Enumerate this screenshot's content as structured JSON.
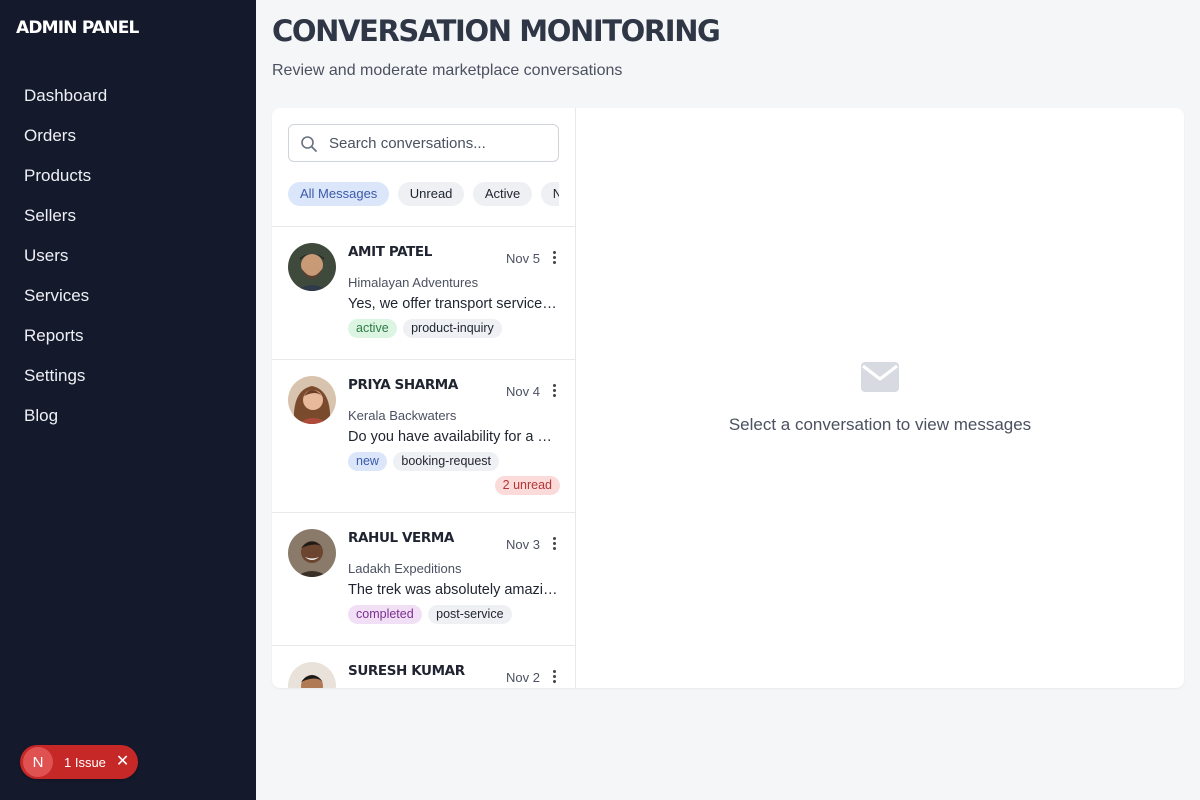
{
  "sidebar": {
    "brand": "ADMIN PANEL",
    "items": [
      {
        "label": "Dashboard"
      },
      {
        "label": "Orders"
      },
      {
        "label": "Products"
      },
      {
        "label": "Sellers"
      },
      {
        "label": "Users"
      },
      {
        "label": "Services"
      },
      {
        "label": "Reports"
      },
      {
        "label": "Settings"
      },
      {
        "label": "Blog"
      }
    ]
  },
  "issue_badge": {
    "initial": "N",
    "label": "1 Issue",
    "close_icon": "close-icon",
    "color": "#c62828"
  },
  "header": {
    "title": "CONVERSATION MONITORING",
    "subtitle": "Review and moderate marketplace conversations"
  },
  "search": {
    "placeholder": "Search conversations...",
    "value": "",
    "icon": "search-icon"
  },
  "filters": [
    {
      "label": "All Messages",
      "active": true
    },
    {
      "label": "Unread",
      "active": false
    },
    {
      "label": "Active",
      "active": false
    },
    {
      "label": "Ne",
      "active": false
    }
  ],
  "conversations": [
    {
      "name": "AMIT PATEL",
      "date": "Nov 5",
      "shop": "Himalayan Adventures",
      "message": "Yes, we offer transport services from the city center.",
      "tags": [
        {
          "label": "active",
          "style": "green"
        },
        {
          "label": "product-inquiry",
          "style": "gray"
        }
      ],
      "unread": ""
    },
    {
      "name": "PRIYA SHARMA",
      "date": "Nov 4",
      "shop": "Kerala Backwaters",
      "message": "Do you have availability for a houseboat stay next weekend?",
      "tags": [
        {
          "label": "new",
          "style": "blue"
        },
        {
          "label": "booking-request",
          "style": "gray"
        }
      ],
      "unread": "2 unread"
    },
    {
      "name": "RAHUL VERMA",
      "date": "Nov 3",
      "shop": "Ladakh Expeditions",
      "message": "The trek was absolutely amazing, thank you!",
      "tags": [
        {
          "label": "completed",
          "style": "purple"
        },
        {
          "label": "post-service",
          "style": "gray"
        }
      ],
      "unread": ""
    },
    {
      "name": "SURESH KUMAR",
      "date": "Nov 2",
      "shop": "",
      "message": "",
      "tags": [],
      "unread": ""
    }
  ],
  "empty_state": {
    "icon": "envelope-icon",
    "text": "Select a conversation to view messages"
  },
  "colors": {
    "sidebar_bg": "#141a2c",
    "accent_blue": "#3b5aa8",
    "unread_red": "#b23636",
    "active_green": "#2d7a44",
    "completed_purple": "#7b2f91"
  }
}
